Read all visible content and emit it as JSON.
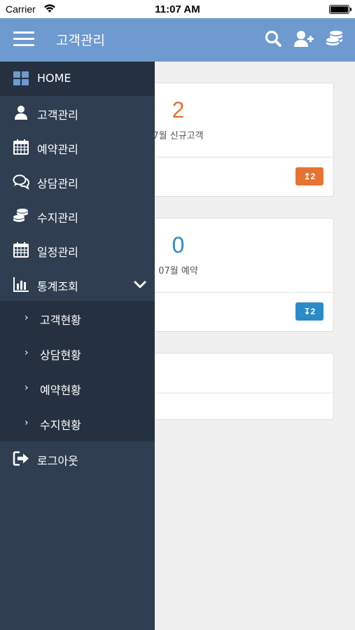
{
  "status_bar": {
    "carrier": "Carrier",
    "time": "11:07 AM"
  },
  "header": {
    "title": "고객관리"
  },
  "colors": {
    "header": "#6f9ad0",
    "drawer": "#2f3e50",
    "orange": "#e67332",
    "blue": "#2b8ac8"
  },
  "cards": [
    {
      "value": "2",
      "label": "7월 신규고객",
      "badge": "↥2",
      "color": "#e67332"
    },
    {
      "value": "0",
      "label": "07월 예약",
      "badge": "↧2",
      "color": "#2b8ac8"
    },
    {
      "value": "",
      "label": "",
      "badge": "",
      "color": ""
    }
  ],
  "menu": {
    "items": [
      {
        "label": "HOME",
        "icon": "grid-icon"
      },
      {
        "label": "고객관리",
        "icon": "user-icon"
      },
      {
        "label": "예약관리",
        "icon": "calendar-icon"
      },
      {
        "label": "상담관리",
        "icon": "chat-icon"
      },
      {
        "label": "수지관리",
        "icon": "coins-icon"
      },
      {
        "label": "일정관리",
        "icon": "calendar-icon"
      },
      {
        "label": "통계조회",
        "icon": "bar-chart-icon"
      }
    ],
    "sub_items": [
      "고객현황",
      "상담현황",
      "예약현황",
      "수지현황"
    ],
    "logout": "로그아웃"
  }
}
